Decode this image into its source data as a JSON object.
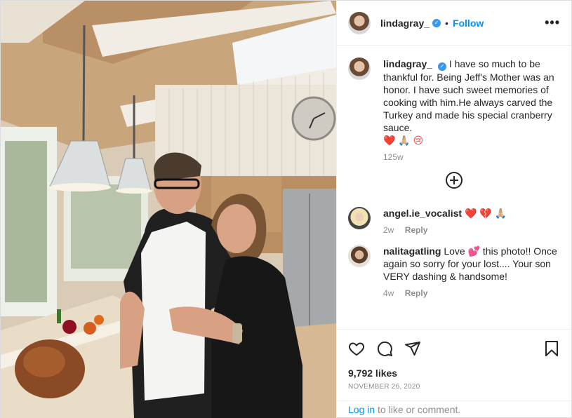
{
  "post": {
    "author": "lindagray_",
    "follow_label": "Follow",
    "dot": "•",
    "more_label": "•••",
    "caption": {
      "username": "lindagray_",
      "text": "I have so much to be thankful for. Being Jeff's Mother was an honor. I have such sweet memories of cooking with him.He always carved the Turkey and made his special cranberry sauce.",
      "emoji": "❤️ 🙏🏼 😢",
      "time": "125w"
    },
    "comments": [
      {
        "username": "angel.ie_vocalist",
        "text": "❤️ 💔 🙏🏼",
        "time": "2w",
        "reply_label": "Reply"
      },
      {
        "username": "nalitagatling",
        "text": "Love 💕 this photo!! Once again so sorry for your lost.... Your son VERY dashing & handsome!",
        "time": "4w",
        "reply_label": "Reply"
      }
    ],
    "likes": "9,792 likes",
    "date": "NOVEMBER 26, 2020",
    "login": {
      "link": "Log in",
      "rest": " to like or comment."
    },
    "icons": [
      "verified-badge-icon",
      "more-options-icon",
      "load-more-comments-icon",
      "heart-icon",
      "comment-icon",
      "share-icon",
      "bookmark-icon"
    ]
  },
  "colors": {
    "link_blue": "#0095f6",
    "verified_blue": "#3897f0",
    "text": "#262626",
    "muted": "#8e8e8e"
  }
}
